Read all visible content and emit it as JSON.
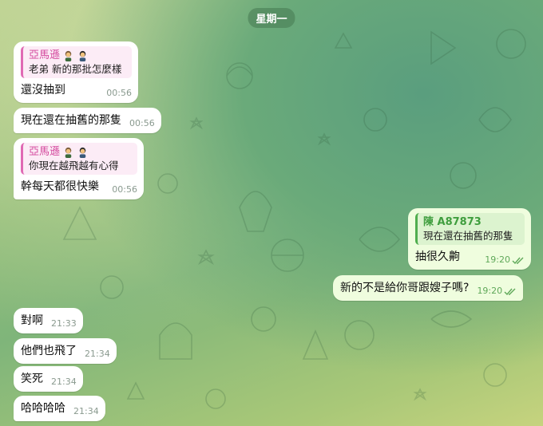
{
  "date_divider": "星期一",
  "colors": {
    "reply_pink": "#e06ab4",
    "reply_green": "#4fae4e",
    "outgoing_bubble": "#effdde"
  },
  "messages": [
    {
      "direction": "in",
      "reply": {
        "name": "亞馬遜",
        "text": "老弟 新的那批怎麼樣"
      },
      "text": "還沒抽到",
      "time": "00:56"
    },
    {
      "direction": "in",
      "text": "現在還在抽舊的那隻",
      "time": "00:56"
    },
    {
      "direction": "in",
      "reply": {
        "name": "亞馬遜",
        "text": "你現在越飛越有心得"
      },
      "text": "幹每天都很快樂",
      "time": "00:56"
    },
    {
      "direction": "out",
      "reply": {
        "name": "陳 A87873",
        "text": "現在還在抽舊的那隻"
      },
      "text": "抽很久齁",
      "time": "19:20",
      "status_icon": "double-check-icon"
    },
    {
      "direction": "out",
      "text": "新的不是給你哥跟嫂子嗎?",
      "time": "19:20",
      "status_icon": "double-check-icon"
    },
    {
      "direction": "in",
      "text": "對啊",
      "time": "21:33"
    },
    {
      "direction": "in",
      "text": "他們也飛了",
      "time": "21:34"
    },
    {
      "direction": "in",
      "text": "笑死",
      "time": "21:34"
    },
    {
      "direction": "in",
      "text": "哈哈哈哈",
      "time": "21:34"
    }
  ]
}
